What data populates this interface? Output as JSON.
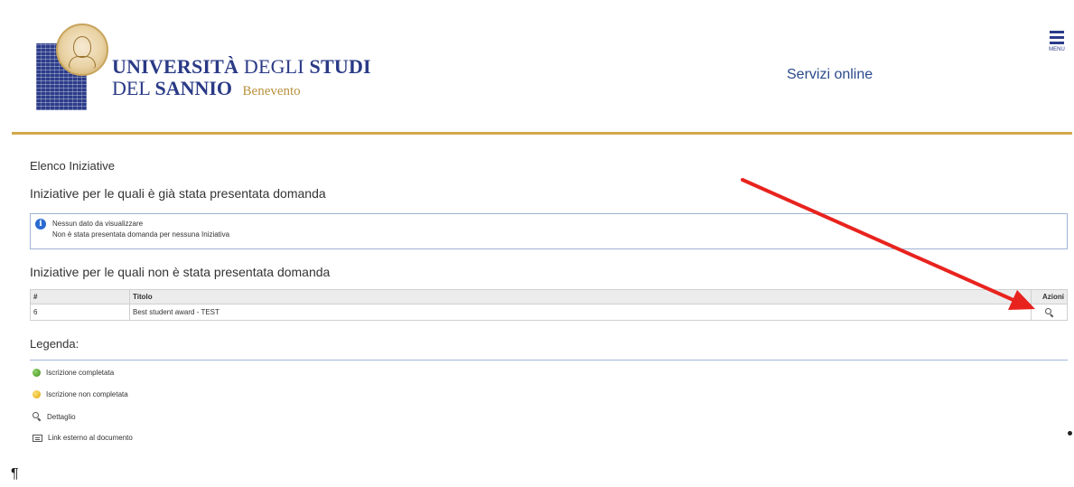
{
  "header": {
    "uni_line1_a": "UNIVERSITÀ",
    "uni_line1_b": "DEGLI",
    "uni_line1_c": "STUDI",
    "uni_line2_a": "DEL",
    "uni_line2_b": "SANNIO",
    "uni_city": "Benevento",
    "servizi_label": "Servizi online",
    "menu_label": "MENU",
    "brand_color": "#2c3c8a",
    "accent_color": "#d4a84b"
  },
  "main": {
    "heading": "Elenco Iniziative",
    "section_presented": "Iniziative per le quali è già stata presentata domanda",
    "info_title": "Nessun dato da visualizzare",
    "info_text": "Non è stata presentata domanda per nessuna Iniziativa",
    "section_not_presented": "Iniziative per le quali non è stata presentata domanda",
    "table": {
      "headers": [
        "#",
        "Titolo",
        "Azioni"
      ],
      "rows": [
        {
          "num": "6",
          "title": "Best student award - TEST",
          "action_icon": "zoom-detail-icon"
        }
      ]
    },
    "legend_title": "Legenda:",
    "legend": [
      {
        "icon": "green-dot-icon",
        "label": "Iscrizione completata"
      },
      {
        "icon": "yellow-dot-icon",
        "label": "Iscrizione non completata"
      },
      {
        "icon": "magnifier-icon",
        "label": "Dettaglio"
      },
      {
        "icon": "external-link-icon",
        "label": "Link esterno al documento"
      }
    ],
    "pilcrow": "¶",
    "annotation_arrow_color": "#e8231e"
  }
}
